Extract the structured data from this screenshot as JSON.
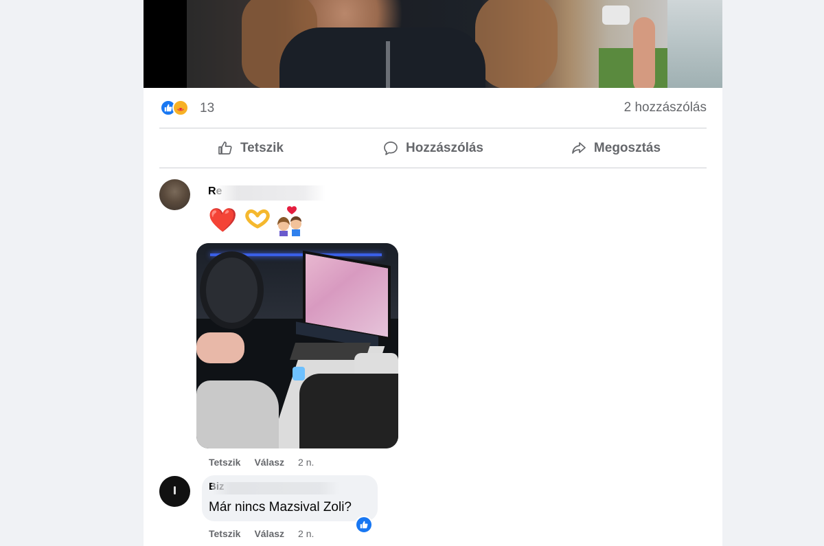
{
  "post": {
    "reactions": {
      "icons": [
        "like-icon",
        "care-icon"
      ],
      "count": "13"
    },
    "comment_count_label": "2 hozzászólás",
    "actions": {
      "like": "Tetszik",
      "comment": "Hozzászólás",
      "share": "Megosztás"
    }
  },
  "comments": [
    {
      "author_visible": "Re",
      "emojis": [
        "❤️",
        "🫶",
        "👩‍❤️‍👨"
      ],
      "actions": {
        "like": "Tetszik",
        "reply": "Válasz",
        "time": "2 n."
      }
    },
    {
      "author_visible": "Biz",
      "text": "Már nincs Mazsival Zoli?",
      "reaction_icon": "like-icon",
      "actions": {
        "like": "Tetszik",
        "reply": "Válasz",
        "time": "2 n."
      }
    }
  ],
  "colors": {
    "accent": "#1877f2",
    "muted_text": "#65676b",
    "background": "#f0f2f5",
    "heart": "#e41e3f"
  }
}
